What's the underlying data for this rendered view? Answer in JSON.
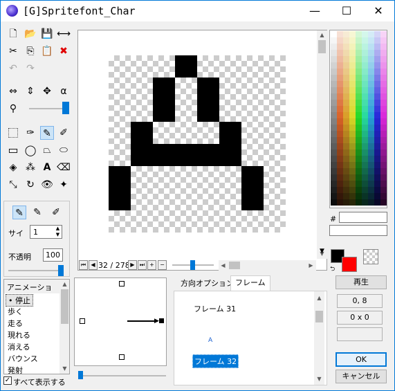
{
  "window": {
    "title": "[G]Spritefont_Char"
  },
  "toolbar": {
    "size_label": "サイ",
    "size_value": "1",
    "opacity_label": "不透明",
    "opacity_value": "100"
  },
  "animation": {
    "header": "アニメーション",
    "items": [
      "停止",
      "歩く",
      "走る",
      "現れる",
      "消える",
      "バウンス",
      "発射"
    ],
    "selected_index": 0,
    "show_all_label": "すべて表示する",
    "show_all_checked": true
  },
  "frame_nav": {
    "counter": "32 / 278"
  },
  "tabs": {
    "direction": "方向オプション",
    "frame": "フレーム",
    "active": "frame"
  },
  "frames": [
    {
      "label": "フレーム 31",
      "glyph": ""
    },
    {
      "label": "フレーム 32",
      "glyph": "A",
      "selected": true
    }
  ],
  "palette": {
    "hash_label": "#",
    "hex_value": "",
    "fg_color": "#000000",
    "bg_color": "#ff0000"
  },
  "right_panel": {
    "play_button": "再生",
    "position": "0, 8",
    "size": "0 x 0",
    "ok_button": "OK",
    "cancel_button": "キャンセル"
  }
}
